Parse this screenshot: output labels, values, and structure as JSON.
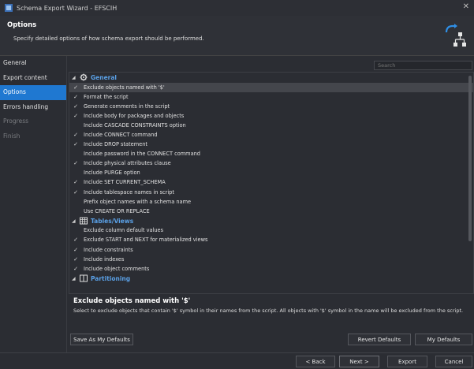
{
  "window": {
    "title": "Schema Export Wizard - EFSCIH",
    "close_label": "✕"
  },
  "header": {
    "title": "Options",
    "description": "Specify detailed options of how schema export should be performed."
  },
  "nav": {
    "items": [
      {
        "label": "General",
        "state": "normal"
      },
      {
        "label": "Export content",
        "state": "normal"
      },
      {
        "label": "Options",
        "state": "active"
      },
      {
        "label": "Errors handling",
        "state": "normal"
      },
      {
        "label": "Progress",
        "state": "disabled"
      },
      {
        "label": "Finish",
        "state": "disabled"
      }
    ]
  },
  "search": {
    "placeholder": "Search"
  },
  "groups": [
    {
      "name": "General",
      "options": [
        {
          "label": "Exclude objects named with '$'",
          "checked": true,
          "selected": true
        },
        {
          "label": "Format the script",
          "checked": true
        },
        {
          "label": "Generate comments in the script",
          "checked": true
        },
        {
          "label": "Include body for packages and objects",
          "checked": true
        },
        {
          "label": "Include CASCADE CONSTRAINTS option",
          "checked": false
        },
        {
          "label": "Include CONNECT command",
          "checked": true
        },
        {
          "label": "Include DROP statement",
          "checked": true
        },
        {
          "label": "Include password in the CONNECT command",
          "checked": false
        },
        {
          "label": "Include physical attributes clause",
          "checked": true
        },
        {
          "label": "Include PURGE option",
          "checked": false
        },
        {
          "label": "Include SET CURRENT_SCHEMA",
          "checked": true
        },
        {
          "label": "Include tablespace names in script",
          "checked": true
        },
        {
          "label": "Prefix object names with a schema name",
          "checked": false
        },
        {
          "label": "Use CREATE OR REPLACE",
          "checked": false
        }
      ]
    },
    {
      "name": "Tables/Views",
      "options": [
        {
          "label": "Exclude column default values",
          "checked": false
        },
        {
          "label": "Exclude START and NEXT for materialized views",
          "checked": true
        },
        {
          "label": "Include constraints",
          "checked": true
        },
        {
          "label": "Include indexes",
          "checked": true
        },
        {
          "label": "Include object comments",
          "checked": true
        }
      ]
    },
    {
      "name": "Partitioning",
      "options": []
    }
  ],
  "description": {
    "title": "Exclude objects named with '$'",
    "text": "Select to exclude objects that contain '$' symbol in their names from the script. All objects with '$' symbol in the name will be excluded from the script."
  },
  "buttons": {
    "save_defaults": "Save As My Defaults",
    "revert_defaults": "Revert Defaults",
    "my_defaults": "My Defaults",
    "back": "< Back",
    "next": "Next >",
    "export": "Export",
    "cancel": "Cancel"
  },
  "colors": {
    "accent": "#1f78d1",
    "group_header": "#5aa0e6"
  }
}
